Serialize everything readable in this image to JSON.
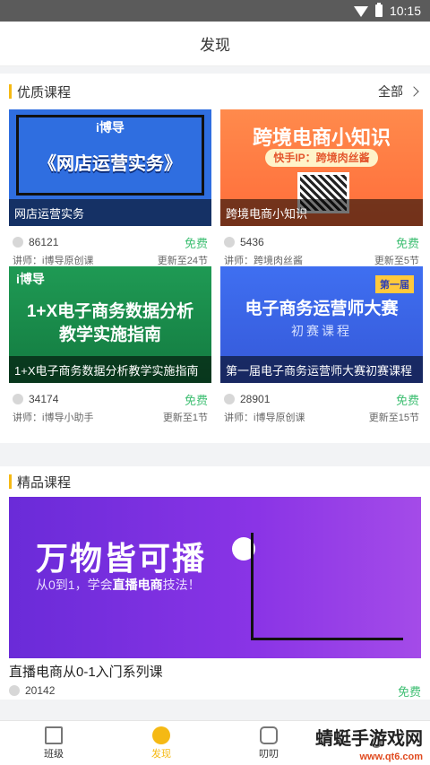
{
  "status_bar": {
    "time": "10:15"
  },
  "header": {
    "title": "发现"
  },
  "section_premium": {
    "title": "优质课程",
    "more_label": "全部",
    "courses": [
      {
        "caption": "网店运营实务",
        "thumb_text": "《网店运营实务》",
        "logo": "i博导",
        "views": "86121",
        "price": "免费",
        "teacher": "讲师：i博导原创课",
        "updated": "更新至24节"
      },
      {
        "caption": "跨境电商小知识",
        "thumb_text": "跨境电商小知识",
        "pill": "快手IP：跨境肉丝酱",
        "views": "5436",
        "price": "免费",
        "teacher": "讲师：跨境肉丝酱",
        "updated": "更新至5节"
      },
      {
        "caption": "1+X电子商务数据分析教学实施指南",
        "thumb_text": "1+X电子商务数据分析\n教学实施指南",
        "logo": "i博导",
        "views": "34174",
        "price": "免费",
        "teacher": "讲师：i博导小助手",
        "updated": "更新至1节"
      },
      {
        "caption": "第一届电子商务运营师大赛初赛课程",
        "thumb_text": "电子商务运营师大赛",
        "sub": "初赛课程",
        "badge": "第一届",
        "views": "28901",
        "price": "免费",
        "teacher": "讲师：i博导原创课",
        "updated": "更新至15节"
      }
    ]
  },
  "section_featured": {
    "title": "精品课程",
    "banner_title": "万物皆可播",
    "banner_sub_prefix": "从0到1，学会",
    "banner_sub_bold": "直播电商",
    "banner_sub_suffix": "技法！",
    "course_title": "直播电商从0-1入门系列课",
    "views": "20142",
    "price": "免费"
  },
  "tabs": [
    {
      "label": "班级",
      "icon": "book-icon"
    },
    {
      "label": "发现",
      "icon": "compass-icon"
    },
    {
      "label": "叨叨",
      "icon": "chat-icon"
    },
    {
      "label": "",
      "icon": "user-icon"
    }
  ],
  "watermark": {
    "line1": "蜻蜓手游戏网",
    "line2": "www.qt6.com"
  },
  "colors": {
    "accent": "#f5b914",
    "free": "#3fbf73"
  }
}
